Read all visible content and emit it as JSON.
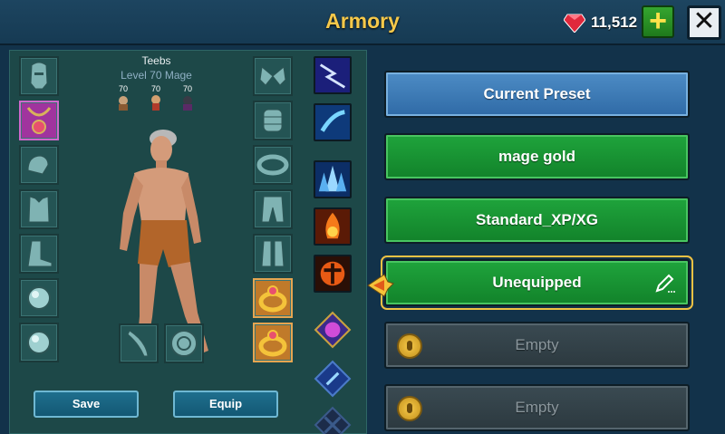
{
  "header": {
    "title": "Armory",
    "currency": "11,512"
  },
  "character": {
    "name": "Teebs",
    "level_class": "Level 70 Mage",
    "pets": [
      {
        "level": "70"
      },
      {
        "level": "70"
      },
      {
        "level": "70"
      }
    ]
  },
  "buttons": {
    "save": "Save",
    "equip": "Equip"
  },
  "presets": [
    {
      "label": "Current Preset",
      "style": "blue"
    },
    {
      "label": "mage gold",
      "style": "green"
    },
    {
      "label": "Standard_XP/XG",
      "style": "green"
    },
    {
      "label": "Unequipped",
      "style": "green",
      "selected": true
    },
    {
      "label": "Empty",
      "style": "locked"
    },
    {
      "label": "Empty",
      "style": "locked"
    }
  ],
  "equipment_slots_left": [
    "helmet-icon",
    "amulet-icon",
    "shoulders-icon",
    "chest-armor-icon",
    "boots-icon",
    "orb-ring-icon",
    "orb-ring-icon"
  ],
  "equipment_slots_right": [
    "gloves-icon",
    "bracers-icon",
    "belt-icon",
    "leggings-icon",
    "greaves-icon",
    "gold-ring-icon",
    "gold-ring-icon"
  ],
  "weapon_slots": [
    "sword-icon",
    "shield-icon"
  ],
  "skills": [
    "lightning-skill",
    "ice-bolt-skill",
    "ice-crystal-skill",
    "fire-skill",
    "fire-figure-skill",
    "arcane-figure-skill",
    "blue-rune-skill",
    "locked-skill"
  ]
}
